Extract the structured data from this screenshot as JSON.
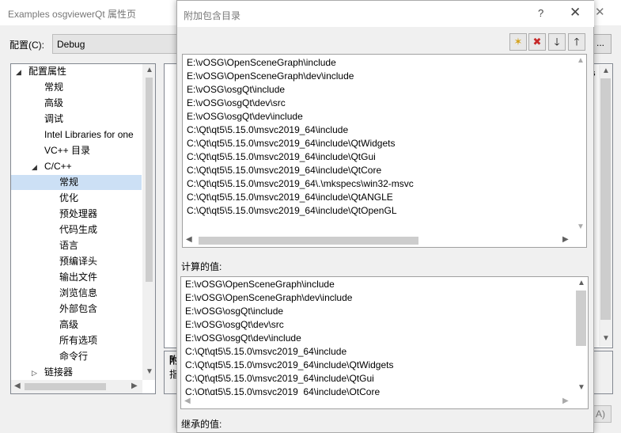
{
  "background_window": {
    "title": "Examples osgviewerQt 属性页",
    "config_label": "配置(C):",
    "config_value": "Debug",
    "side_button": "...",
    "grid_cutoff_text": "s",
    "desc_title": "附",
    "desc_text": "指",
    "apply_fragment": "A)",
    "tree": {
      "items": [
        {
          "label": "配置属性",
          "expander": "◢"
        },
        {
          "label": "常规"
        },
        {
          "label": "高级"
        },
        {
          "label": "调试"
        },
        {
          "label": "Intel Libraries for one"
        },
        {
          "label": "VC++ 目录"
        },
        {
          "label": "C/C++",
          "expander": "◢"
        },
        {
          "label": "常规"
        },
        {
          "label": "优化"
        },
        {
          "label": "预处理器"
        },
        {
          "label": "代码生成"
        },
        {
          "label": "语言"
        },
        {
          "label": "预编译头"
        },
        {
          "label": "输出文件"
        },
        {
          "label": "浏览信息"
        },
        {
          "label": "外部包含"
        },
        {
          "label": "高级"
        },
        {
          "label": "所有选项"
        },
        {
          "label": "命令行"
        },
        {
          "label": "链接器",
          "expander": "▷"
        }
      ]
    }
  },
  "dialog": {
    "title": "附加包含目录",
    "help_glyph": "?",
    "close_glyph": "✕",
    "toolbar": {
      "new_line_glyph": "✶",
      "delete_glyph": "✖",
      "move_down_glyph": "🡓",
      "move_up_glyph": "🡑"
    },
    "paths": [
      "E:\\vOSG\\OpenSceneGraph\\include",
      "E:\\vOSG\\OpenSceneGraph\\dev\\include",
      "E:\\vOSG\\osgQt\\include",
      "E:\\vOSG\\osgQt\\dev\\src",
      "E:\\vOSG\\osgQt\\dev\\include",
      "C:\\Qt\\qt5\\5.15.0\\msvc2019_64\\include",
      "C:\\Qt\\qt5\\5.15.0\\msvc2019_64\\include\\QtWidgets",
      "C:\\Qt\\qt5\\5.15.0\\msvc2019_64\\include\\QtGui",
      "C:\\Qt\\qt5\\5.15.0\\msvc2019_64\\include\\QtCore",
      "C:\\Qt\\qt5\\5.15.0\\msvc2019_64\\.\\mkspecs\\win32-msvc",
      "C:\\Qt\\qt5\\5.15.0\\msvc2019_64\\include\\QtANGLE",
      "C:\\Qt\\qt5\\5.15.0\\msvc2019_64\\include\\QtOpenGL"
    ],
    "evaluated_label": "计算的值:",
    "evaluated": [
      "E:\\vOSG\\OpenSceneGraph\\include",
      "E:\\vOSG\\OpenSceneGraph\\dev\\include",
      "E:\\vOSG\\osgQt\\include",
      "E:\\vOSG\\osgQt\\dev\\src",
      "E:\\vOSG\\osgQt\\dev\\include",
      "C:\\Qt\\qt5\\5.15.0\\msvc2019_64\\include",
      "C:\\Qt\\qt5\\5.15.0\\msvc2019_64\\include\\QtWidgets",
      "C:\\Qt\\qt5\\5.15.0\\msvc2019_64\\include\\QtGui",
      "C:\\Qt\\qt5\\5.15.0\\msvc2019_64\\include\\QtCore"
    ],
    "inherited_label": "继承的值:"
  }
}
